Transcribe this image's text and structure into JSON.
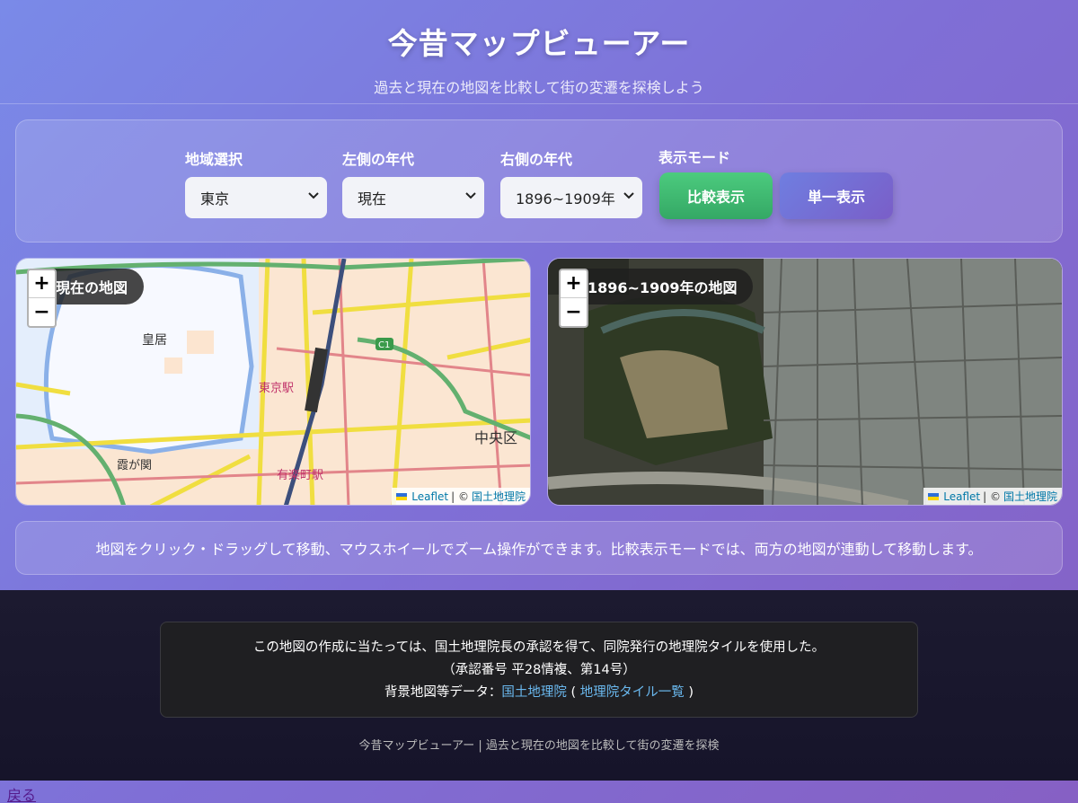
{
  "header": {
    "title": "今昔マップビューアー",
    "subtitle": "過去と現在の地図を比較して街の変遷を探検しよう"
  },
  "controls": {
    "region": {
      "label": "地域選択",
      "value": "東京"
    },
    "left_era": {
      "label": "左側の年代",
      "value": "現在"
    },
    "right_era": {
      "label": "右側の年代",
      "value": "1896~1909年"
    },
    "mode": {
      "label": "表示モード",
      "compare": "比較表示",
      "single": "単一表示"
    }
  },
  "left_map": {
    "label": "現在の地図",
    "zoom_in": "+",
    "zoom_out": "−",
    "places": [
      "皇居",
      "東京駅",
      "霞が関",
      "有楽町駅",
      "中央区",
      "C1"
    ],
    "attribution": {
      "leaflet": "Leaflet",
      "sep": "| ©",
      "gsi": "国土地理院"
    }
  },
  "right_map": {
    "label": "1896~1909年の地図",
    "zoom_in": "+",
    "zoom_out": "−",
    "attribution": {
      "leaflet": "Leaflet",
      "sep": "| ©",
      "gsi": "国土地理院"
    }
  },
  "info_text": "地図をクリック・ドラッグして移動、マウスホイールでズーム操作ができます。比較表示モードでは、両方の地図が連動して移動します。",
  "footer": {
    "line1": "この地図の作成に当たっては、国土地理院長の承認を得て、同院発行の地理院タイルを使用した。",
    "line2": "（承認番号 平28情複、第14号）",
    "line3_prefix": "背景地図等データ：",
    "link_gsi": "国土地理院",
    "paren_open": "(",
    "link_tiles": "地理院タイル一覧",
    "paren_close": ")",
    "note": "今昔マップビューアー | 過去と現在の地図を比較して街の変遷を探検"
  },
  "back_link": "戻る",
  "colors": {
    "compare_button": "#3db870",
    "single_button": "#7070d8",
    "link": "#6ab8ee"
  }
}
